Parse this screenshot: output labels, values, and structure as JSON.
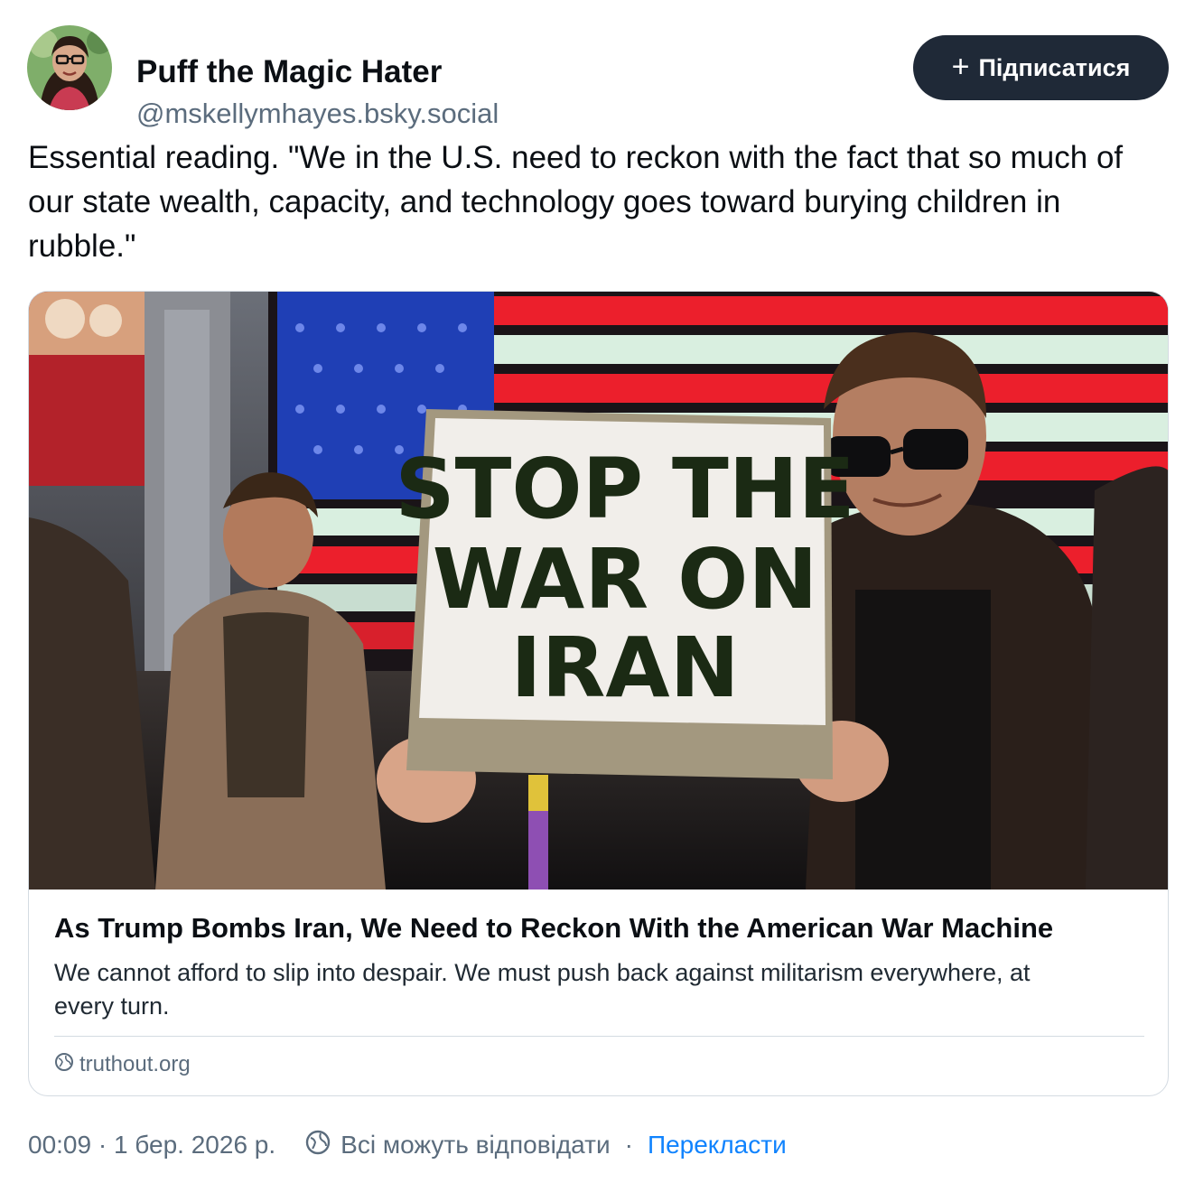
{
  "author": {
    "display_name": "Puff the Magic Hater",
    "handle": "@mskellymhayes.bsky.social"
  },
  "follow_button": {
    "label": "Підписатися",
    "icon": "plus-icon"
  },
  "post": {
    "text": "Essential reading. \"We in the U.S. need to reckon with the fact that so much of our state wealth, capacity, and technology goes toward burying children in rubble.\""
  },
  "link_card": {
    "image_sign_text": [
      "STOP THE",
      "WAR ON",
      "IRAN"
    ],
    "title": "As Trump Bombs Iran, We Need to Reckon With the American War Machine",
    "description": "We cannot afford to slip into despair. We must push back against militarism everywhere, at every turn.",
    "domain": "truthout.org",
    "domain_icon": "globe-icon"
  },
  "meta": {
    "timestamp": "00:09 · 1 бер. 2026 р.",
    "separator": "·",
    "reply_setting": "Всі можуть відповідати",
    "reply_icon": "globe-icon",
    "translate_label": "Перекласти"
  },
  "colors": {
    "follow_bg": "#1f2937",
    "secondary_text": "#5b6c7d",
    "link": "#1083fe",
    "border": "#d4dbe2"
  }
}
